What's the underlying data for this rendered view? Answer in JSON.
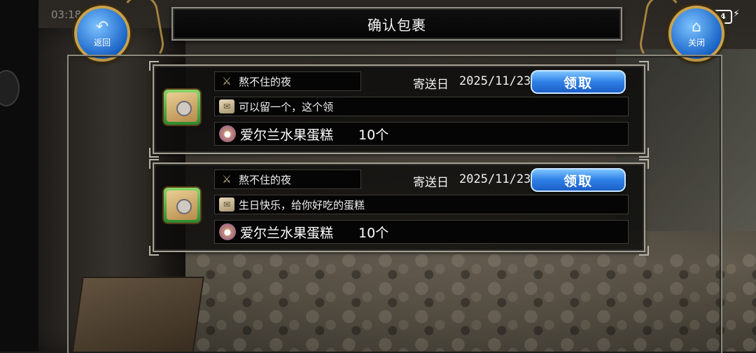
{
  "status_bar": {
    "time": "03:18",
    "battery": "94",
    "charging_icon": "bolt-icon"
  },
  "nav": {
    "back": {
      "label": "返回",
      "icon": "back-arrow-icon"
    },
    "close": {
      "label": "关闭",
      "icon": "home-icon"
    }
  },
  "dialog": {
    "title": "确认包裹"
  },
  "parcels": [
    {
      "sender": "熬不住的夜",
      "date_label": "寄送日",
      "date": "2025/11/23",
      "claim_label": "领取",
      "message": "可以留一个，这个领",
      "item_name": "爱尔兰水果蛋糕",
      "item_qty": "10个"
    },
    {
      "sender": "熬不住的夜",
      "date_label": "寄送日",
      "date": "2025/11/23",
      "claim_label": "领取",
      "message": "生日快乐，给你好吃的蛋糕",
      "item_name": "爱尔兰水果蛋糕",
      "item_qty": "10个"
    }
  ],
  "colors": {
    "claim_button": "#2f7fe6",
    "frame": "#a6a294",
    "ornament_gold": "#c9a24a"
  }
}
